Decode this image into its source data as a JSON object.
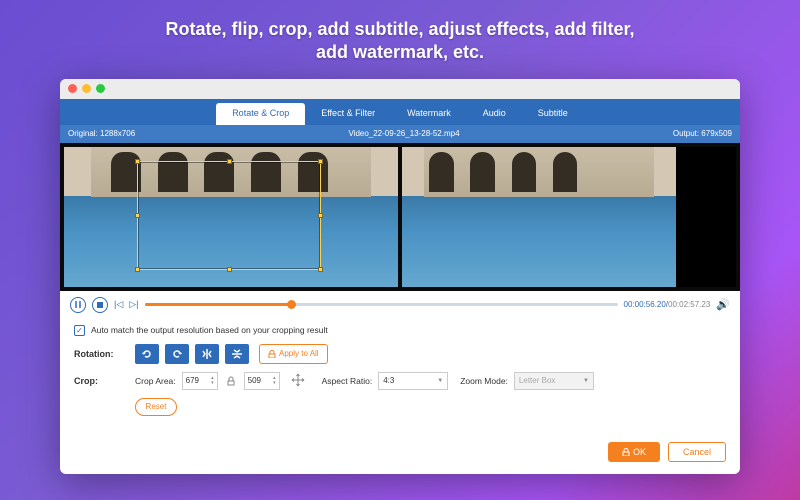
{
  "hero": {
    "line1": "Rotate, flip, crop, add subtitle, adjust effects, add filter,",
    "line2": "add watermark, etc."
  },
  "traffic_colors": {
    "close": "#ff5f57",
    "min": "#febc2e",
    "max": "#28c840"
  },
  "tabs": [
    {
      "label": "Rotate & Crop",
      "active": true
    },
    {
      "label": "Effect & Filter",
      "active": false
    },
    {
      "label": "Watermark",
      "active": false
    },
    {
      "label": "Audio",
      "active": false
    },
    {
      "label": "Subtitle",
      "active": false
    }
  ],
  "resolution_bar": {
    "original_label": "Original: 1288x706",
    "filename": "Video_22-09-26_13-28-52.mp4",
    "output_label": "Output: 679x509"
  },
  "playback": {
    "current": "00:00:56.20",
    "total": "00:02:57.23",
    "progress_pct": 31
  },
  "auto_match": {
    "checked": true,
    "label": "Auto match the output resolution based on your cropping result"
  },
  "rotation": {
    "label": "Rotation:",
    "apply_all": "Apply to All"
  },
  "crop": {
    "label": "Crop:",
    "area_label": "Crop Area:",
    "width": "679",
    "height": "509",
    "aspect_label": "Aspect Ratio:",
    "aspect_value": "4:3",
    "zoom_label": "Zoom Mode:",
    "zoom_value": "Letter Box",
    "reset": "Reset"
  },
  "footer": {
    "ok": "OK",
    "cancel": "Cancel"
  }
}
